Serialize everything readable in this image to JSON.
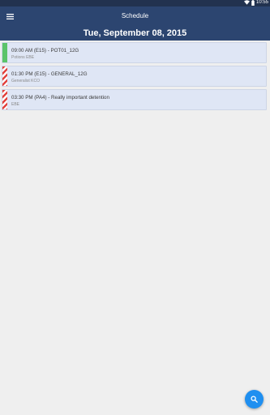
{
  "status_bar": {
    "time": "10:55",
    "icons": [
      "wifi-icon",
      "battery-icon"
    ]
  },
  "app_bar": {
    "title": "Schedule",
    "menu_icon": "menu-icon"
  },
  "date_header": "Tue, September 08, 2015",
  "schedule_items": [
    {
      "title": "09:00 AM (E15) - POT01_12G",
      "subtitle": "Potions EBE",
      "marker": "solid",
      "marker_color": "#5cc46a"
    },
    {
      "title": "01:30 PM (E15) - GENERAL_12G",
      "subtitle": "Generalist KCO",
      "marker": "striped",
      "marker_color": "#e2433e"
    },
    {
      "title": "03:30 PM (PA4) - Really important detention",
      "subtitle": "EBE",
      "marker": "striped",
      "marker_color": "#e2433e"
    }
  ],
  "fab": {
    "icon": "search-icon"
  },
  "colors": {
    "appbar": "#2c4570",
    "statusbar": "#22324f",
    "background": "#efefef",
    "item_background": "#dfe6f5",
    "fab": "#1f8ff0"
  }
}
